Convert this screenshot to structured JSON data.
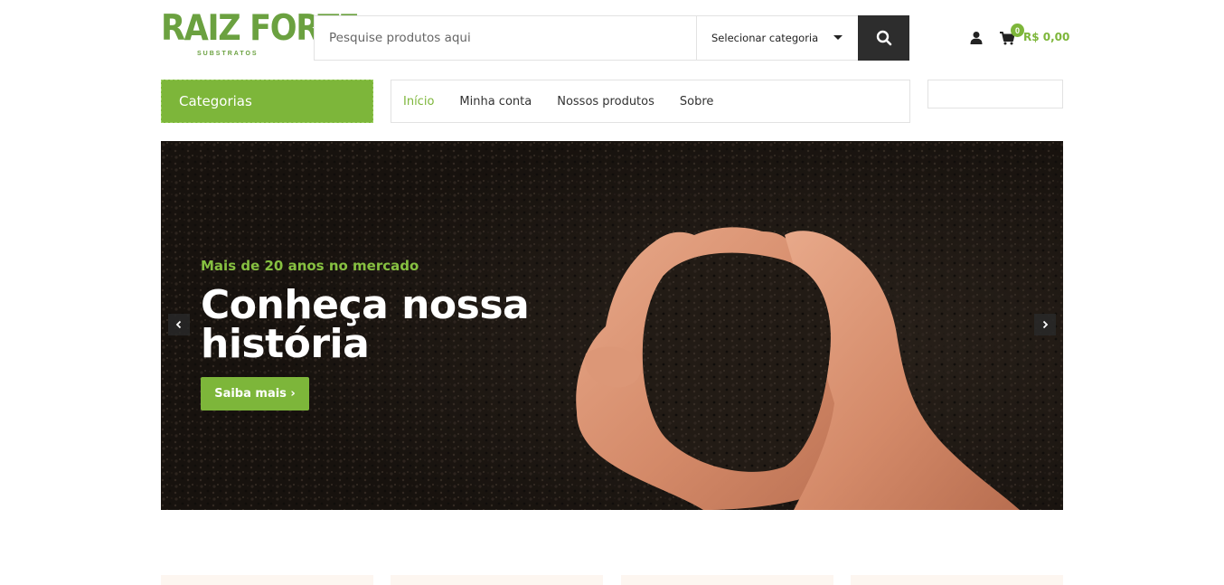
{
  "header": {
    "logo_text": "RAIZ FORTE",
    "logo_subtext": "SUBSTRATOS",
    "search": {
      "placeholder": "Pesquise produtos aqui",
      "category_label": "Selecionar categoria"
    },
    "cart": {
      "count": "0",
      "total": "R$ 0,00"
    },
    "icons": [
      "search-icon",
      "user-icon",
      "cart-icon"
    ]
  },
  "nav": {
    "categories_label": "Categorias",
    "links": [
      {
        "label": "Início",
        "active": true
      },
      {
        "label": "Minha conta",
        "active": false
      },
      {
        "label": "Nossos produtos",
        "active": false
      },
      {
        "label": "Sobre",
        "active": false
      }
    ]
  },
  "hero": {
    "kicker": "Mais de 20 anos no mercado",
    "title": "Conheça nossa história",
    "cta": "Saiba mais ›"
  },
  "colors": {
    "brand_green": "#7db63a",
    "dark": "#2d2d2d"
  }
}
